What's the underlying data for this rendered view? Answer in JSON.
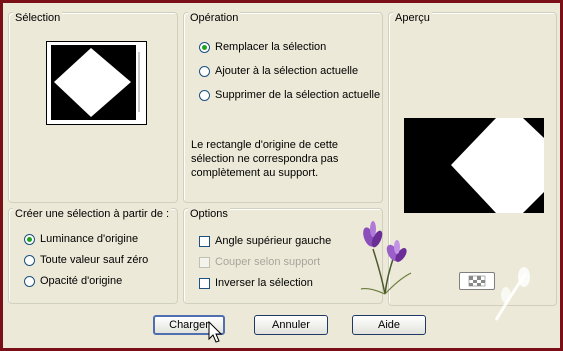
{
  "selection": {
    "title": "Sélection"
  },
  "operation": {
    "title": "Opération",
    "options": [
      {
        "label": "Remplacer la sélection",
        "checked": true
      },
      {
        "label": "Ajouter à la sélection actuelle",
        "checked": false
      },
      {
        "label": "Supprimer de la sélection actuelle",
        "checked": false
      }
    ],
    "note_lines": [
      "Le rectangle d'origine de cette",
      "sélection ne correspondra pas",
      "complètement au support."
    ]
  },
  "preview": {
    "title": "Aperçu"
  },
  "source": {
    "title": "Créer une sélection à partir de :",
    "options": [
      {
        "label": "Luminance d'origine",
        "checked": true
      },
      {
        "label": "Toute valeur sauf zéro",
        "checked": false
      },
      {
        "label": "Opacité d'origine",
        "checked": false
      }
    ]
  },
  "options": {
    "title": "Options",
    "items": [
      {
        "label": "Angle supérieur gauche",
        "checked": false,
        "disabled": false
      },
      {
        "label": "Couper selon support",
        "checked": false,
        "disabled": true
      },
      {
        "label": "Inverser la sélection",
        "checked": false,
        "disabled": false
      }
    ]
  },
  "buttons": {
    "load": "Charger",
    "cancel": "Annuler",
    "help": "Aide"
  },
  "colors": {
    "frame": "#7a0f17",
    "dialog_bg": "#ece9d8",
    "radio_dot": "#21a121"
  }
}
